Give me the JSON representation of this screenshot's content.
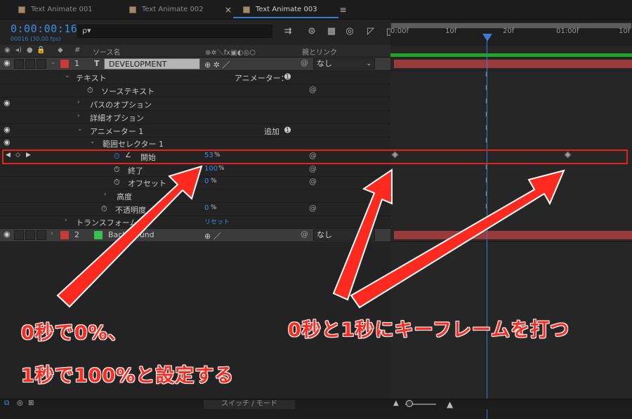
{
  "tabs": [
    {
      "label": "Text Animate 001"
    },
    {
      "label": "Text Animate 002"
    },
    {
      "label": "Text Animate 003"
    }
  ],
  "tab_close": "×",
  "tab_menu": "≡",
  "timecode": "0:00:00:16",
  "fps": "00016 (30.00 fps)",
  "search_icon": "ρ▾",
  "toolbar_icons": [
    "comp-flowchart-icon",
    "shy-icon",
    "frame-blend-icon",
    "motion-blur-icon",
    "graph-editor-icon"
  ],
  "columns": {
    "source_name": "ソース名",
    "parent_link": "親とリンク",
    "hash": "#"
  },
  "rows": [
    {
      "kind": "layer",
      "number": "1",
      "type_glyph": "T",
      "name": "DEVELOPMENT",
      "parent": "なし"
    },
    {
      "kind": "prop",
      "label": "テキスト",
      "right": "アニメーター："
    },
    {
      "kind": "prop",
      "label": "ソーステキスト"
    },
    {
      "kind": "prop",
      "label": "パスのオプション"
    },
    {
      "kind": "prop",
      "label": "詳細オプション"
    },
    {
      "kind": "prop",
      "label": "アニメーター 1",
      "right": "追加"
    },
    {
      "kind": "prop",
      "label": "範囲セレクター 1"
    },
    {
      "kind": "prop",
      "label": "開始",
      "value": "53",
      "unit": "%"
    },
    {
      "kind": "prop",
      "label": "終了",
      "value": "100",
      "unit": "%"
    },
    {
      "kind": "prop",
      "label": "オフセット",
      "value": "0",
      "unit": "%"
    },
    {
      "kind": "prop",
      "label": "高度"
    },
    {
      "kind": "prop",
      "label": "不透明度",
      "value": "0",
      "unit": "%"
    },
    {
      "kind": "prop",
      "label": "トランスフォーム",
      "right": "リセット"
    },
    {
      "kind": "layer",
      "number": "2",
      "name": "Background",
      "parent": "なし"
    }
  ],
  "ruler": {
    "ticks": [
      "0:00f",
      "10f",
      "20f",
      "01:00f",
      "10f"
    ]
  },
  "footer": {
    "switch_mode": "スイッチ / モード"
  },
  "annotations": {
    "left_line1": "0秒で0%、",
    "left_line2": "1秒で100%と設定する",
    "right_line": "0秒と1秒にキーフレームを打つ"
  },
  "colors": {
    "accent": "#3a7bd5",
    "layer1_label": "#c93a3a",
    "layer2_label": "#3bbf4f",
    "annotation": "#ff2a1f"
  }
}
